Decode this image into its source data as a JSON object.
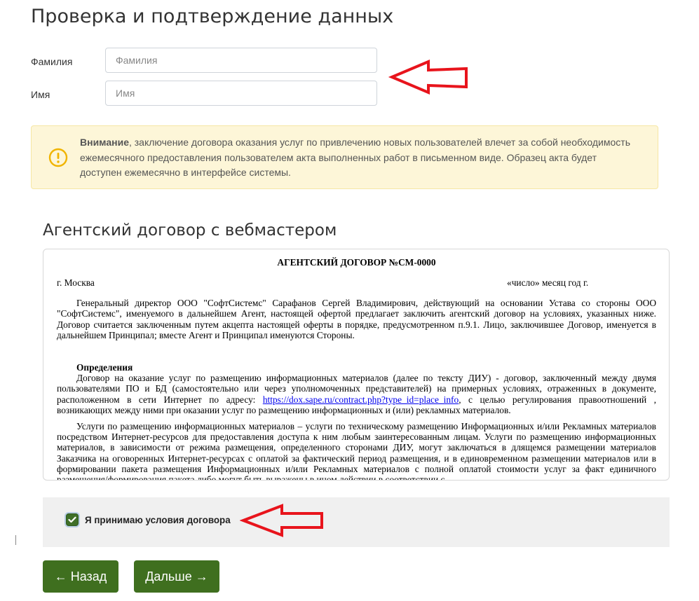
{
  "page": {
    "title": "Проверка и подтверждение данных"
  },
  "form": {
    "surname": {
      "label": "Фамилия",
      "placeholder": "Фамилия",
      "value": ""
    },
    "name": {
      "label": "Имя",
      "placeholder": "Имя",
      "value": ""
    }
  },
  "warning": {
    "icon": "exclamation-circle-icon",
    "bold": "Внимание",
    "text": ", заключение договора оказания услуг по привлечению новых пользователей влечет за собой необходимость ежемесячного предоставления пользователем акта выполненных работ в письменном виде. Образец акта будет доступен ежемесячно в интерфейсе системы."
  },
  "contract": {
    "heading": "Агентский договор с вебмастером",
    "doc_title": "АГЕНТСКИЙ ДОГОВОР №СМ-0000",
    "city": "г. Москва",
    "date": "«число» месяц год г.",
    "p1": "Генеральный директор ООО \"СофтСистемс\" Сарафанов Сергей Владимирович, действующий на основании Устава со стороны ООО \"СофтСистемс\", именуемого в дальнейшем Агент, настоящей офертой предлагает заключить агентский договор на условиях, указанных ниже. Договор считается заключенным путем акцепта настоящей оферты в порядке, предусмотренном п.9.1. Лицо, заключившее Договор, именуется в дальнейшем Принципал; вместе Агент и Принципал именуются Стороны.",
    "definitions_title": "Определения",
    "p2_before": "Договор на оказание услуг по размещению информационных материалов (далее по тексту ДИУ) - договор, заключенный между двумя пользователями ПО и БД (самостоятельно или через уполномоченных представителей) на примерных условиях, отраженных в документе, расположенном в сети Интернет по адресу: ",
    "p2_link": "https://dox.sape.ru/contract.php?type_id=place_info",
    "p2_after": ", с целью регулирования правоотношений , возникающих между ними при оказании услуг по размещению информационных и (или) рекламных материалов.",
    "p3": "Услуги по размещению информационных материалов – услуги по техническому размещению Информационных и/или Рекламных материалов посредством Интернет-ресурсов для предоставления доступа к ним любым заинтересованным лицам. Услуги по размещению информационных материалов, в зависимости от режима размещения, определенного сторонами ДИУ, могут заключаться в длящемся размещении материалов Заказчика на оговоренных Интернет-ресурсах с оплатой за фактический период размещения, и в единовременном размещении материалов или в формировании пакета размещения Информационных и/или Рекламных материалов с полной оплатой стоимости услуг за факт единичного размещения/формирования пакета либо могут быть выражены в ином действии в соответствии с"
  },
  "accept": {
    "label": "Я принимаю условия договора",
    "checked": true
  },
  "buttons": {
    "back": "← Назад",
    "next": "Дальше →"
  },
  "colors": {
    "primary_green": "#3f6f1f",
    "warning_bg": "#fdf6d8",
    "warning_icon": "#f0b400",
    "annotation_arrow": "#e8141c"
  }
}
